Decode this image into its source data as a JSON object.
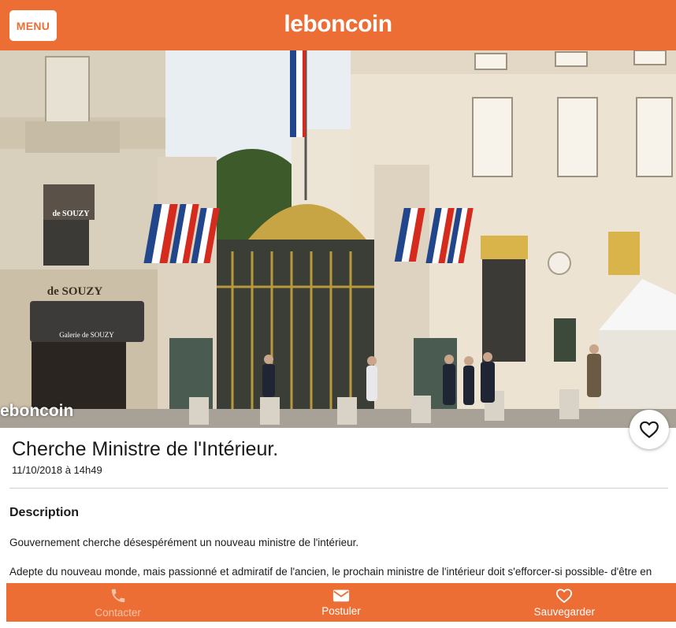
{
  "header": {
    "menu_label": "MENU",
    "logo_text": "leboncoin",
    "brand_color": "#ec6e35"
  },
  "photo": {
    "watermark": "eboncoin",
    "sign_souzy_top": "de SOUZY",
    "sign_souzy_big": "de SOUZY",
    "sign_galerie": "Galerie de SOUZY"
  },
  "ad": {
    "title": "Cherche Ministre de l'Intérieur.",
    "date": "11/10/2018 à 14h49"
  },
  "description": {
    "heading": "Description",
    "paragraph1": "Gouvernement cherche désespérément un nouveau ministre de l'intérieur.",
    "paragraph2": "Adepte du nouveau monde, mais passionné et admiratif de l'ancien, le prochain ministre de l'intérieur doit s'efforcer-si possible- d'être en"
  },
  "bottom_bar": {
    "contact_label": "Contacter",
    "apply_label": "Postuler",
    "save_label": "Sauvegarder",
    "icons": [
      "phone-icon",
      "envelope-icon",
      "heart-icon"
    ]
  }
}
